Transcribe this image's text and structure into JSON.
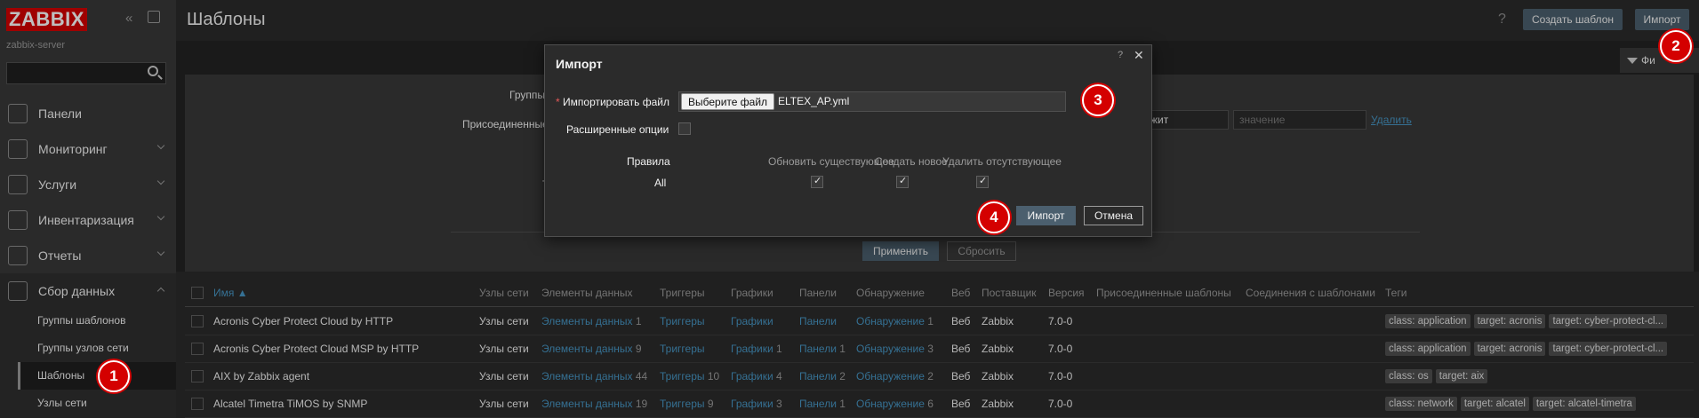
{
  "sidebar": {
    "logo": "ZABBIX",
    "server_name": "zabbix-server",
    "menu": [
      {
        "label": "Панели",
        "icon": "dashboard-icon"
      },
      {
        "label": "Мониторинг",
        "icon": "monitoring-icon"
      },
      {
        "label": "Услуги",
        "icon": "services-icon"
      },
      {
        "label": "Инвентаризация",
        "icon": "inventory-icon"
      },
      {
        "label": "Отчеты",
        "icon": "reports-icon"
      },
      {
        "label": "Сбор данных",
        "icon": "data-collection-icon"
      }
    ],
    "submenu": [
      "Группы шаблонов",
      "Группы узлов сети",
      "Шаблоны",
      "Узлы сети"
    ]
  },
  "header": {
    "title": "Шаблоны",
    "help": "?",
    "create_button": "Создать шаблон",
    "import_button": "Импорт"
  },
  "filter": {
    "tab_label": "Фильтр",
    "tab_label_visible": "Фи",
    "label_groups": "Группы",
    "label_linked": "Присоединенные",
    "partial_select": "жит",
    "value_placeholder": "значение",
    "remove_link": "Удалить",
    "label_hidden": "Т",
    "apply": "Применить",
    "reset": "Сбросить"
  },
  "table": {
    "headers": [
      "Имя ▲",
      "Узлы сети",
      "Элементы данных",
      "Триггеры",
      "Графики",
      "Панели",
      "Обнаружение",
      "Веб",
      "Поставщик",
      "Версия",
      "Присоединенные шаблоны",
      "Соединения с шаблонами",
      "Теги"
    ],
    "rows": [
      {
        "name": "Acronis Cyber Protect Cloud by HTTP",
        "hosts": "Узлы сети",
        "items": "Элементы данных",
        "items_count": "1",
        "triggers": "Триггеры",
        "triggers_count": "",
        "graphs": "Графики",
        "graphs_count": "",
        "dashboards": "Панели",
        "dashboards_count": "",
        "discovery": "Обнаружение",
        "discovery_count": "1",
        "web": "Веб",
        "vendor": "Zabbix",
        "version": "7.0-0",
        "tags": [
          "class: application",
          "target: acronis",
          "target: cyber-protect-cl..."
        ]
      },
      {
        "name": "Acronis Cyber Protect Cloud MSP by HTTP",
        "hosts": "Узлы сети",
        "items": "Элементы данных",
        "items_count": "9",
        "triggers": "Триггеры",
        "triggers_count": "",
        "graphs": "Графики",
        "graphs_count": "1",
        "dashboards": "Панели",
        "dashboards_count": "1",
        "discovery": "Обнаружение",
        "discovery_count": "3",
        "web": "Веб",
        "vendor": "Zabbix",
        "version": "7.0-0",
        "tags": [
          "class: application",
          "target: acronis",
          "target: cyber-protect-cl..."
        ]
      },
      {
        "name": "AIX by Zabbix agent",
        "hosts": "Узлы сети",
        "items": "Элементы данных",
        "items_count": "44",
        "triggers": "Триггеры",
        "triggers_count": "10",
        "graphs": "Графики",
        "graphs_count": "4",
        "dashboards": "Панели",
        "dashboards_count": "2",
        "discovery": "Обнаружение",
        "discovery_count": "2",
        "web": "Веб",
        "vendor": "Zabbix",
        "version": "7.0-0",
        "tags": [
          "class: os",
          "target: aix"
        ]
      },
      {
        "name": "Alcatel Timetra TiMOS by SNMP",
        "hosts": "Узлы сети",
        "items": "Элементы данных",
        "items_count": "19",
        "triggers": "Триггеры",
        "triggers_count": "9",
        "graphs": "Графики",
        "graphs_count": "3",
        "dashboards": "Панели",
        "dashboards_count": "1",
        "discovery": "Обнаружение",
        "discovery_count": "6",
        "web": "Веб",
        "vendor": "Zabbix",
        "version": "7.0-0",
        "tags": [
          "class: network",
          "target: alcatel",
          "target: alcatel-timetra"
        ]
      }
    ]
  },
  "modal": {
    "title": "Импорт",
    "help": "?",
    "close": "✕",
    "file_label_req": "*",
    "file_label": "Импортировать файл",
    "file_button": "Выберите файл",
    "file_name": "ELTEX_AP.yml",
    "advanced_label": "Расширенные опции",
    "rules_label": "Правила",
    "col_update": "Обновить существующее",
    "col_create": "Создать новое",
    "col_delete": "Удалить отсутствующее",
    "row_all": "All",
    "import_button": "Импорт",
    "cancel_button": "Отмена"
  },
  "steps": [
    "1",
    "2",
    "3",
    "4"
  ],
  "colors": {
    "logo": "#d40000",
    "link": "#4796c4",
    "primary_button": "#4b5f6e",
    "step_marker": "#d40000"
  }
}
